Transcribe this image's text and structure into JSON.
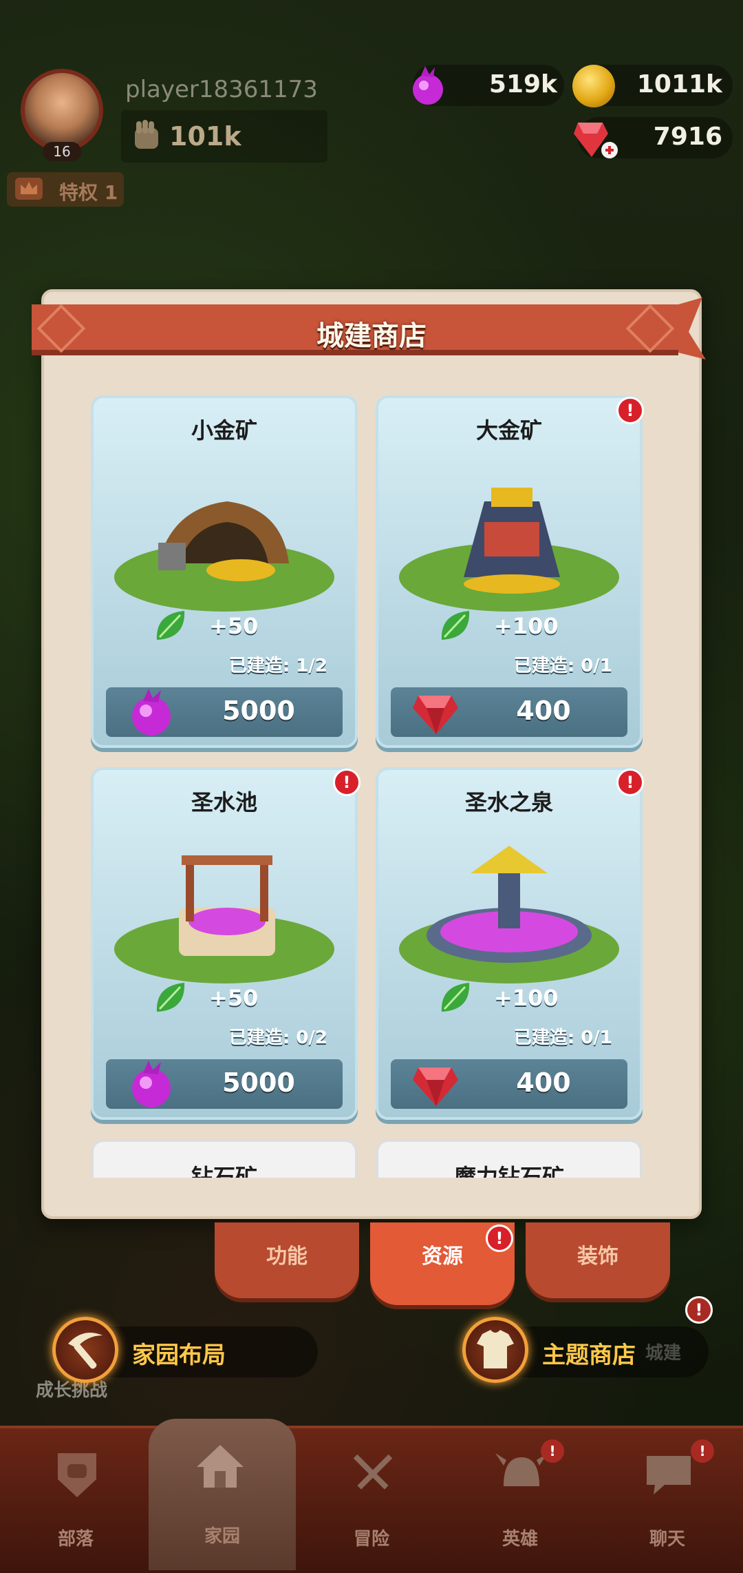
{
  "player": {
    "name": "player18361173",
    "level": "16",
    "power": "101k",
    "privilege": "特权 1"
  },
  "resources": {
    "elixir": "519k",
    "gold": "1011k",
    "gems": "7916"
  },
  "shop": {
    "title": "城建商店",
    "items": [
      {
        "name": "小金矿",
        "bonus": "+50",
        "built": "已建造: 1/2",
        "price": "5000",
        "currency": "elixir-icon",
        "alert": false
      },
      {
        "name": "大金矿",
        "bonus": "+100",
        "built": "已建造: 0/1",
        "price": "400",
        "currency": "gem-icon",
        "alert": true
      },
      {
        "name": "圣水池",
        "bonus": "+50",
        "built": "已建造: 0/2",
        "price": "5000",
        "currency": "elixir-icon",
        "alert": true
      },
      {
        "name": "圣水之泉",
        "bonus": "+100",
        "built": "已建造: 0/1",
        "price": "400",
        "currency": "gem-icon",
        "alert": true
      },
      {
        "name": "钻石矿"
      },
      {
        "name": "魔力钻石矿"
      }
    ]
  },
  "categories": [
    {
      "label": "功能",
      "active": false
    },
    {
      "label": "资源",
      "active": true,
      "alert": "!"
    },
    {
      "label": "装饰",
      "active": false
    }
  ],
  "actions": {
    "home_layout": "家园布局",
    "theme_shop": "主题商店",
    "growth": "成长挑战",
    "build": "城建"
  },
  "alert_mark": "!",
  "nav": [
    {
      "label": "部落",
      "icon": "tribe-icon"
    },
    {
      "label": "家园",
      "icon": "home-icon"
    },
    {
      "label": "冒险",
      "icon": "swords-icon"
    },
    {
      "label": "英雄",
      "icon": "helmet-icon"
    },
    {
      "label": "聊天",
      "icon": "chat-icon"
    }
  ],
  "colors": {
    "banner": "#c8553a",
    "card": "#b8dbe6",
    "price_bar": "#4f7a8c",
    "alert": "#d8202a",
    "action_gold": "#ffc84a"
  }
}
